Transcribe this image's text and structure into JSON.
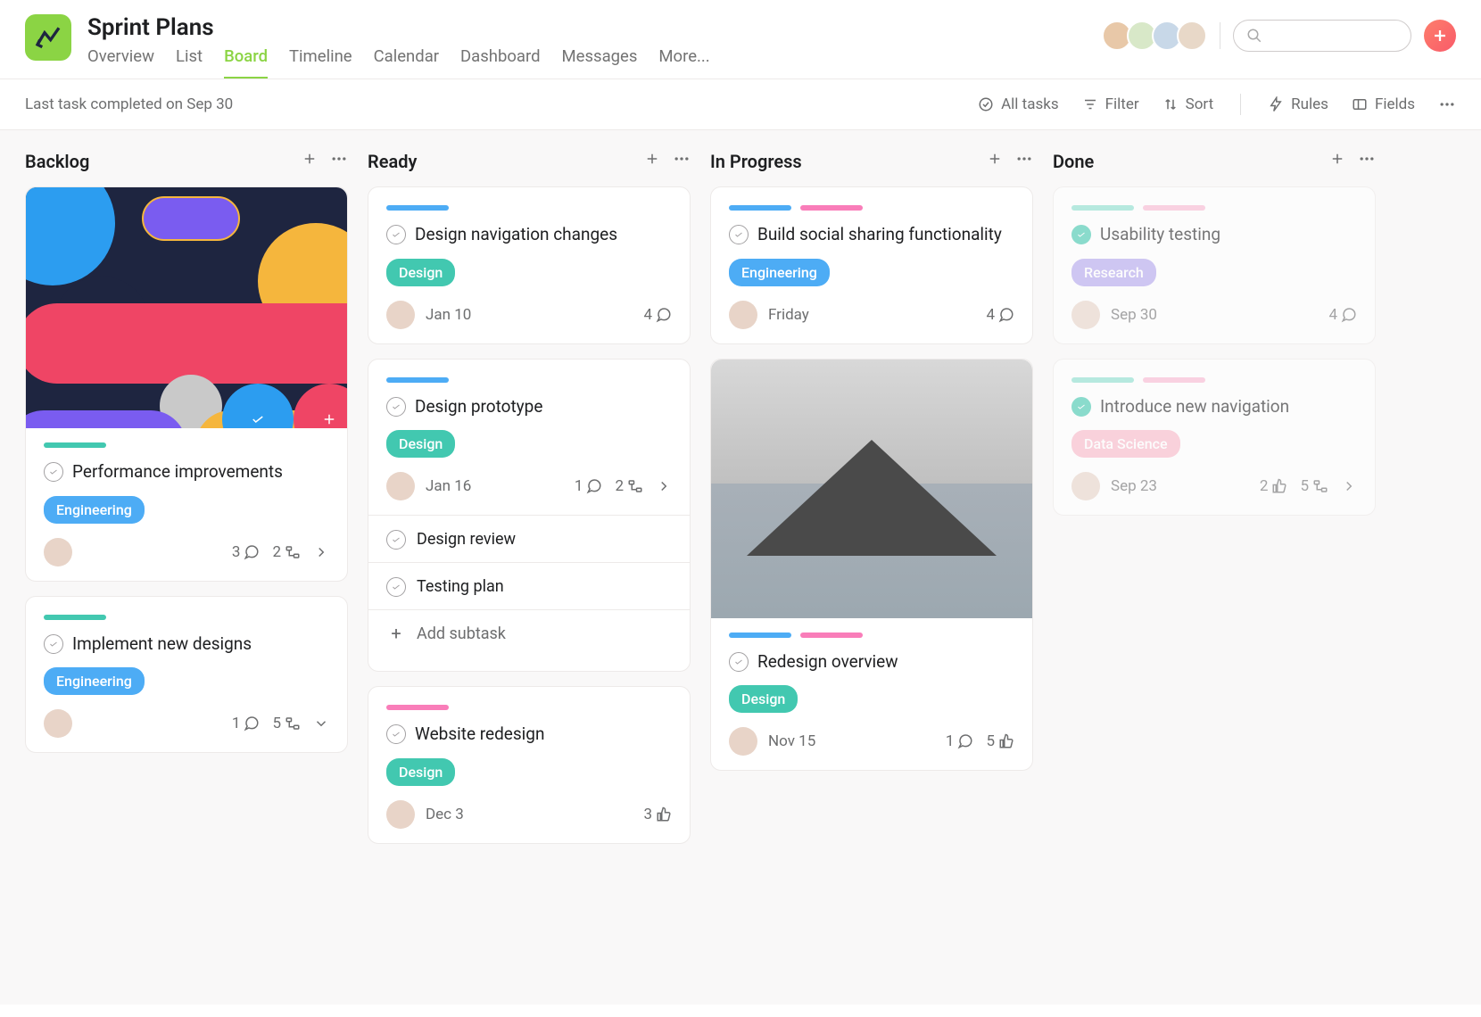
{
  "header": {
    "title": "Sprint Plans",
    "tabs": [
      "Overview",
      "List",
      "Board",
      "Timeline",
      "Calendar",
      "Dashboard",
      "Messages",
      "More..."
    ],
    "active_tab": "Board"
  },
  "toolbar": {
    "status": "Last task completed on Sep 30",
    "all_tasks": "All tasks",
    "filter": "Filter",
    "sort": "Sort",
    "rules": "Rules",
    "fields": "Fields"
  },
  "columns": [
    {
      "title": "Backlog",
      "cards": [
        {
          "has_cover": "abstract",
          "stripes": [
            "teal"
          ],
          "title": "Performance improvements",
          "tag": {
            "label": "Engineering",
            "cls": "engineering"
          },
          "due": "",
          "meta": {
            "comments": 3,
            "subtasks": 2,
            "arrow": "right"
          }
        },
        {
          "stripes": [
            "teal"
          ],
          "title": "Implement new designs",
          "tag": {
            "label": "Engineering",
            "cls": "engineering"
          },
          "due": "",
          "meta": {
            "comments": 1,
            "subtasks": 5,
            "arrow": "down"
          }
        }
      ]
    },
    {
      "title": "Ready",
      "cards": [
        {
          "stripes": [
            "blue"
          ],
          "title": "Design navigation changes",
          "tag": {
            "label": "Design",
            "cls": "design"
          },
          "due": "Jan 10",
          "meta": {
            "comments": 4
          }
        },
        {
          "stripes": [
            "blue"
          ],
          "title": "Design prototype",
          "tag": {
            "label": "Design",
            "cls": "design"
          },
          "due": "Jan 16",
          "meta": {
            "comments": 1,
            "subtasks": 2,
            "arrow": "right"
          },
          "subtasks": [
            "Design review",
            "Testing plan"
          ],
          "add_subtask": "Add subtask"
        },
        {
          "stripes": [
            "pink"
          ],
          "title": "Website redesign",
          "tag": {
            "label": "Design",
            "cls": "design"
          },
          "due": "Dec 3",
          "meta": {
            "likes": 3
          }
        }
      ]
    },
    {
      "title": "In Progress",
      "cards": [
        {
          "stripes": [
            "blue",
            "pink"
          ],
          "title": "Build social sharing functionality",
          "tag": {
            "label": "Engineering",
            "cls": "engineering"
          },
          "due": "Friday",
          "meta": {
            "comments": 4
          }
        },
        {
          "has_cover": "mountain",
          "stripes": [
            "blue",
            "pink"
          ],
          "title": "Redesign overview",
          "tag": {
            "label": "Design",
            "cls": "design"
          },
          "due": "Nov 15",
          "meta": {
            "likes": 5,
            "comments": 1
          }
        }
      ]
    },
    {
      "title": "Done",
      "cards": [
        {
          "done": true,
          "stripes": [
            "tealL",
            "pinkL"
          ],
          "title": "Usability testing",
          "tag": {
            "label": "Research",
            "cls": "research"
          },
          "due": "Sep 30",
          "meta": {
            "comments": 4
          }
        },
        {
          "done": true,
          "stripes": [
            "tealL",
            "pinkL"
          ],
          "title": "Introduce new navigation",
          "tag": {
            "label": "Data Science",
            "cls": "datascience"
          },
          "due": "Sep 23",
          "meta": {
            "likes": 2,
            "subtasks": 5,
            "arrow": "right"
          }
        }
      ]
    }
  ]
}
